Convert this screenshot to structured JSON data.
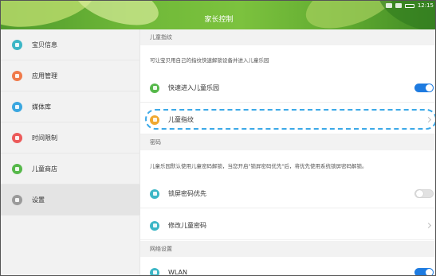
{
  "header": {
    "title": "家长控制",
    "time": "12:15",
    "status_icons": [
      "wifi-icon",
      "signal-icon",
      "battery-icon"
    ]
  },
  "sidebar": {
    "items": [
      {
        "label": "宝贝信息",
        "icon": "baby-info-icon",
        "color": "#3cb6c6",
        "active": false
      },
      {
        "label": "应用管理",
        "icon": "app-manage-icon",
        "color": "#f07a4a",
        "active": false
      },
      {
        "label": "媒体库",
        "icon": "media-library-icon",
        "color": "#3aa7e0",
        "active": false
      },
      {
        "label": "时间限制",
        "icon": "time-limit-icon",
        "color": "#ec5a5a",
        "active": false
      },
      {
        "label": "儿童商店",
        "icon": "kids-store-icon",
        "color": "#56b84a",
        "active": false
      },
      {
        "label": "设置",
        "icon": "settings-icon",
        "color": "#9a9a9a",
        "active": true
      }
    ]
  },
  "sections": {
    "fingerprint": {
      "header": "儿童指纹",
      "description": "可让宝贝用自己的指纹快速解锁设备并进入儿童乐园",
      "quick_enter_label": "快速进入儿童乐园",
      "quick_enter_on": true,
      "fingerprint_label": "儿童指纹"
    },
    "password": {
      "header": "密码",
      "description": "儿童乐园默认使用儿童密码解锁，当您开启\"锁屏密码优先\"后，将优先使用系统锁屏密码解锁。",
      "lockscreen_priority_label": "锁屏密码优先",
      "lockscreen_priority_on": false,
      "change_password_label": "修改儿童密码"
    },
    "network": {
      "header": "网络设置",
      "wlan_label": "WLAN",
      "wlan_on": true
    }
  },
  "colors": {
    "accent": "#1e7be0",
    "highlight": "#3ca9e8",
    "row_icon_green": "#56b84a",
    "row_icon_orange": "#f0a830",
    "row_icon_teal": "#3cb6c6"
  }
}
